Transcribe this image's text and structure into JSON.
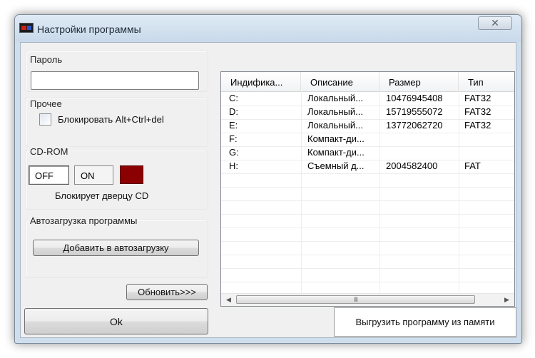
{
  "window": {
    "title": "Настройки программы",
    "close_glyph": "✕"
  },
  "password": {
    "group_label": "Пароль",
    "value": ""
  },
  "other": {
    "group_label": "Прочее",
    "checkbox_label": "Блокировать Alt+Ctrl+del",
    "checked": false
  },
  "cdrom": {
    "group_label": "CD-ROM",
    "off_label": "OFF",
    "on_label": "ON",
    "state": "OFF",
    "indicator_color": "#8b0000",
    "caption": "Блокирует дверцу CD"
  },
  "autoload": {
    "group_label": "Автозагрузка программы",
    "add_button": "Добавить в автозагрузку"
  },
  "refresh_button": "Обновить>>>",
  "ok_button": "Ok",
  "unload_button": "Выгрузить программу из памяти",
  "drives": {
    "columns": [
      "Индифика...",
      "Описание",
      "Размер",
      "Тип"
    ],
    "rows": [
      [
        "C:",
        "Локальный...",
        "10476945408",
        "FAT32"
      ],
      [
        "D:",
        "Локальный...",
        "15719555072",
        "FAT32"
      ],
      [
        "E:",
        "Локальный...",
        "13772062720",
        "FAT32"
      ],
      [
        "F:",
        "Компакт-ди...",
        "",
        ""
      ],
      [
        "G:",
        "Компакт-ди...",
        "",
        ""
      ],
      [
        "H:",
        "Съемный д...",
        "2004582400",
        "FAT"
      ],
      [
        "",
        "",
        "",
        ""
      ],
      [
        "",
        "",
        "",
        ""
      ],
      [
        "",
        "",
        "",
        ""
      ],
      [
        "",
        "",
        "",
        ""
      ],
      [
        "",
        "",
        "",
        ""
      ],
      [
        "",
        "",
        "",
        ""
      ],
      [
        "",
        "",
        "",
        ""
      ],
      [
        "",
        "",
        "",
        ""
      ],
      [
        "",
        "",
        "",
        ""
      ]
    ],
    "scroll_left": "◀",
    "scroll_right": "▶",
    "thumb_grip": "III"
  }
}
